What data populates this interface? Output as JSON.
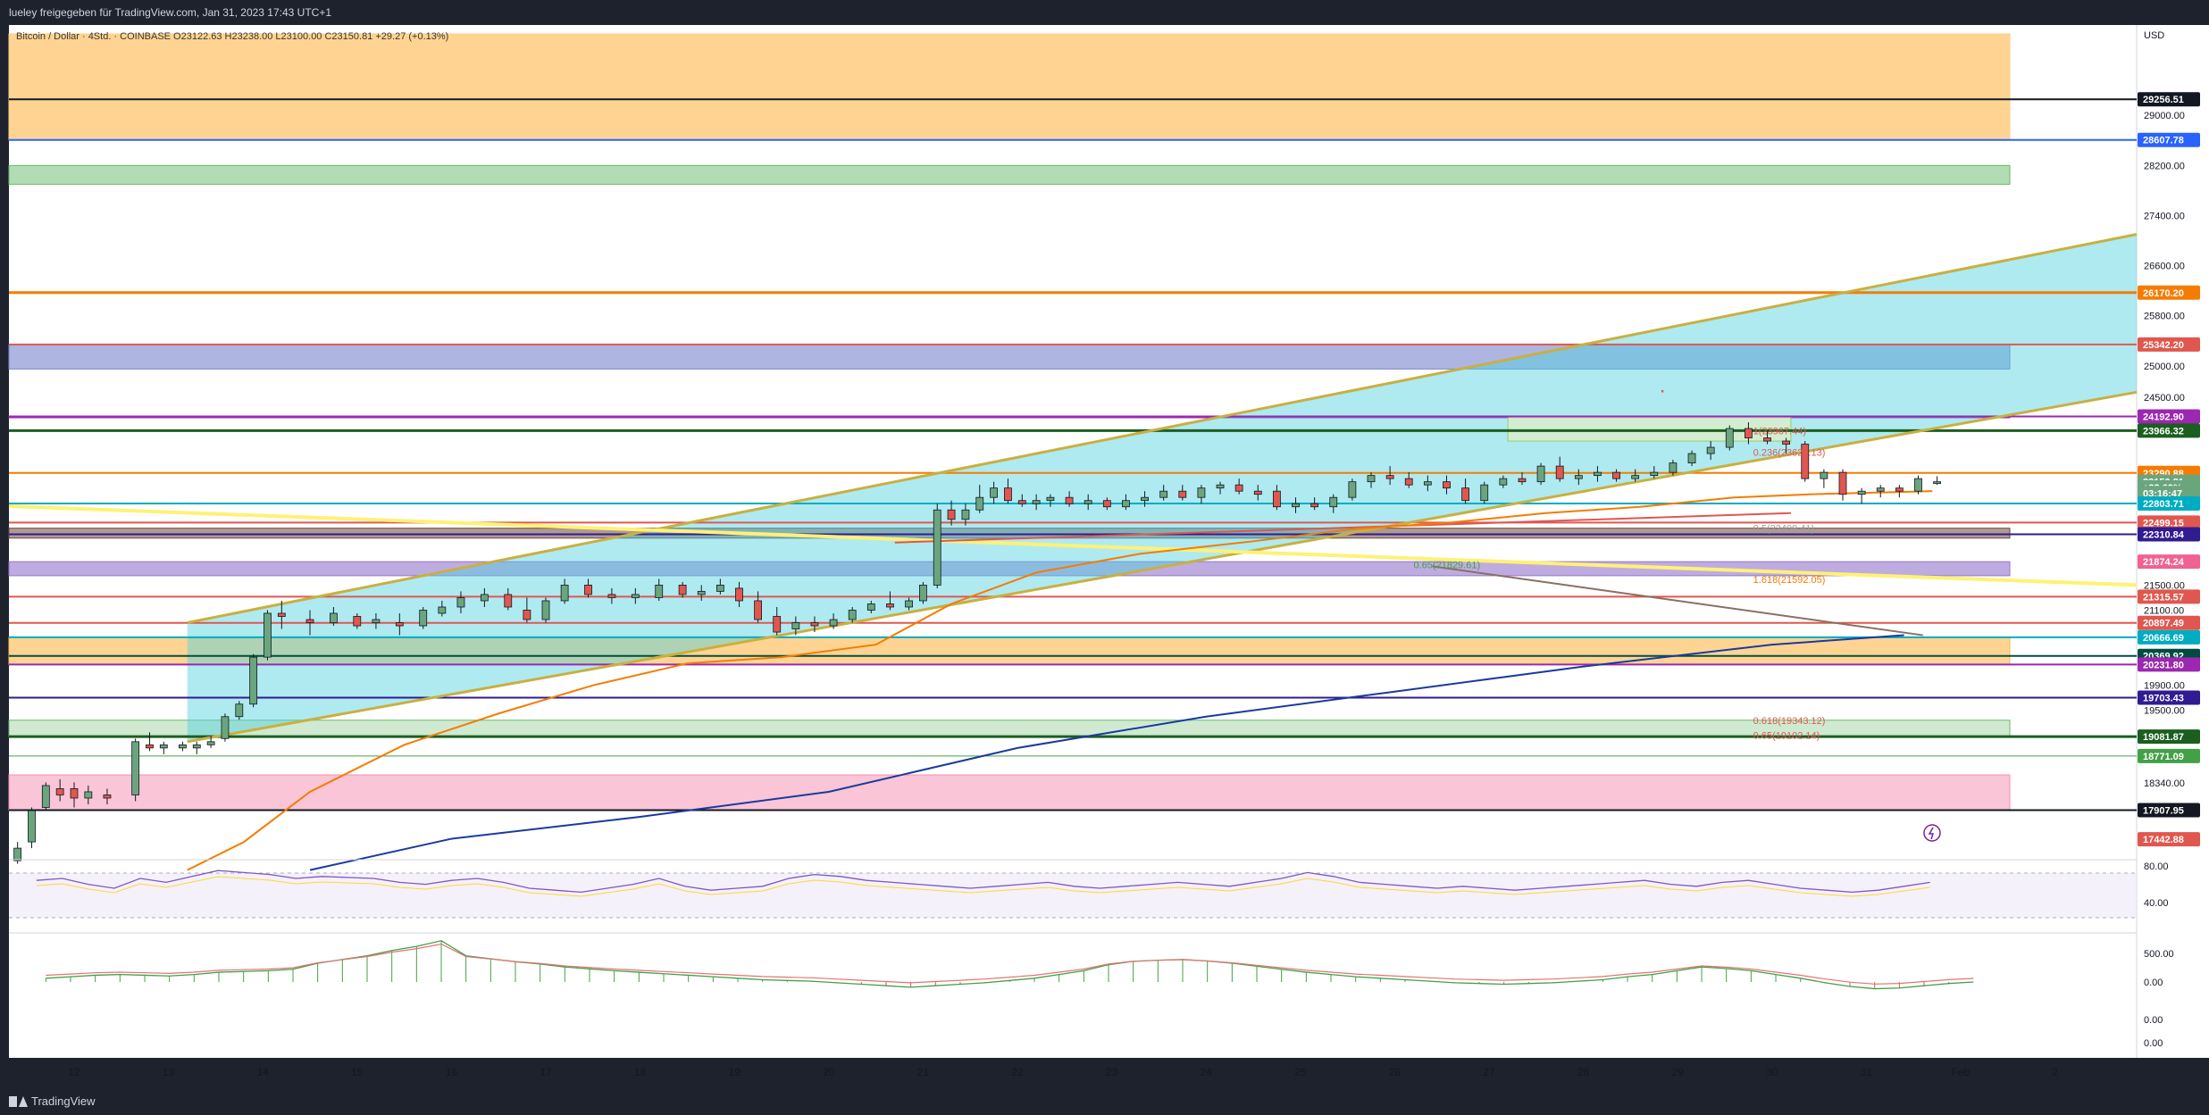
{
  "header": {
    "text": "lueley freigegeben für TradingView.com, Jan 31, 2023 17:43 UTC+1"
  },
  "footer": {
    "brand": "TradingView"
  },
  "legend": {
    "symbol_line": "Bitcoin / Dollar · 4Std. · COINBASE  O23122.63  H23238.00  L23100.00  C23150.81  +29.27 (+0.13%)"
  },
  "colors": {
    "up": "#6aa57e",
    "down": "#e0574f",
    "background": "#ffffff",
    "axis_text": "#131722"
  },
  "chart_data": {
    "type": "candlestick",
    "currency": "USD",
    "ylim": [
      16950,
      30300
    ],
    "x_tick_labels": [
      "12",
      "13",
      "14",
      "15",
      "16",
      "17",
      "18",
      "19",
      "20",
      "21",
      "22",
      "23",
      "24",
      "25",
      "26",
      "27",
      "28",
      "29",
      "30",
      "31",
      "Feb",
      "2"
    ],
    "y_tick_labels": [
      29000,
      28200,
      27400,
      26600,
      25800,
      25000,
      24500,
      21500,
      21100,
      19900,
      19500,
      18340
    ],
    "candles": [
      {
        "x": 11.4,
        "o": 17100,
        "h": 17400,
        "l": 17050,
        "c": 17300
      },
      {
        "x": 11.55,
        "o": 17400,
        "h": 17950,
        "l": 17300,
        "c": 17900
      },
      {
        "x": 11.7,
        "o": 17950,
        "h": 18350,
        "l": 17900,
        "c": 18300
      },
      {
        "x": 11.85,
        "o": 18250,
        "h": 18400,
        "l": 18050,
        "c": 18150
      },
      {
        "x": 12.0,
        "o": 18250,
        "h": 18350,
        "l": 17950,
        "c": 18100
      },
      {
        "x": 12.15,
        "o": 18100,
        "h": 18300,
        "l": 18000,
        "c": 18200
      },
      {
        "x": 12.35,
        "o": 18150,
        "h": 18250,
        "l": 18000,
        "c": 18100
      },
      {
        "x": 12.65,
        "o": 18150,
        "h": 19050,
        "l": 18050,
        "c": 19000
      },
      {
        "x": 12.8,
        "o": 18950,
        "h": 19150,
        "l": 18850,
        "c": 18900
      },
      {
        "x": 12.95,
        "o": 18900,
        "h": 19000,
        "l": 18800,
        "c": 18950
      },
      {
        "x": 13.15,
        "o": 18900,
        "h": 19000,
        "l": 18850,
        "c": 18950
      },
      {
        "x": 13.3,
        "o": 18900,
        "h": 19000,
        "l": 18800,
        "c": 18950
      },
      {
        "x": 13.45,
        "o": 18950,
        "h": 19100,
        "l": 18900,
        "c": 19000
      },
      {
        "x": 13.6,
        "o": 19050,
        "h": 19450,
        "l": 19000,
        "c": 19400
      },
      {
        "x": 13.75,
        "o": 19400,
        "h": 19650,
        "l": 19350,
        "c": 19600
      },
      {
        "x": 13.9,
        "o": 19600,
        "h": 20400,
        "l": 19550,
        "c": 20350
      },
      {
        "x": 14.05,
        "o": 20350,
        "h": 21100,
        "l": 20300,
        "c": 21050
      },
      {
        "x": 14.2,
        "o": 21050,
        "h": 21250,
        "l": 20800,
        "c": 21000
      },
      {
        "x": 14.5,
        "o": 20950,
        "h": 21100,
        "l": 20700,
        "c": 20900
      },
      {
        "x": 14.75,
        "o": 20900,
        "h": 21150,
        "l": 20850,
        "c": 21050
      },
      {
        "x": 15.0,
        "o": 21000,
        "h": 21050,
        "l": 20800,
        "c": 20850
      },
      {
        "x": 15.2,
        "o": 20900,
        "h": 21050,
        "l": 20800,
        "c": 20950
      },
      {
        "x": 15.45,
        "o": 20900,
        "h": 21050,
        "l": 20700,
        "c": 20850
      },
      {
        "x": 15.7,
        "o": 20850,
        "h": 21150,
        "l": 20800,
        "c": 21100
      },
      {
        "x": 15.9,
        "o": 21050,
        "h": 21250,
        "l": 21000,
        "c": 21150
      },
      {
        "x": 16.1,
        "o": 21150,
        "h": 21400,
        "l": 21050,
        "c": 21300
      },
      {
        "x": 16.35,
        "o": 21250,
        "h": 21450,
        "l": 21150,
        "c": 21350
      },
      {
        "x": 16.6,
        "o": 21350,
        "h": 21450,
        "l": 21100,
        "c": 21150
      },
      {
        "x": 16.8,
        "o": 21100,
        "h": 21300,
        "l": 20900,
        "c": 20950
      },
      {
        "x": 17.0,
        "o": 20950,
        "h": 21300,
        "l": 20900,
        "c": 21250
      },
      {
        "x": 17.2,
        "o": 21250,
        "h": 21600,
        "l": 21200,
        "c": 21500
      },
      {
        "x": 17.45,
        "o": 21500,
        "h": 21600,
        "l": 21300,
        "c": 21350
      },
      {
        "x": 17.7,
        "o": 21350,
        "h": 21450,
        "l": 21200,
        "c": 21300
      },
      {
        "x": 17.95,
        "o": 21300,
        "h": 21450,
        "l": 21200,
        "c": 21350
      },
      {
        "x": 18.2,
        "o": 21300,
        "h": 21600,
        "l": 21250,
        "c": 21500
      },
      {
        "x": 18.45,
        "o": 21500,
        "h": 21550,
        "l": 21300,
        "c": 21350
      },
      {
        "x": 18.65,
        "o": 21350,
        "h": 21500,
        "l": 21250,
        "c": 21400
      },
      {
        "x": 18.85,
        "o": 21400,
        "h": 21600,
        "l": 21350,
        "c": 21500
      },
      {
        "x": 19.05,
        "o": 21450,
        "h": 21550,
        "l": 21150,
        "c": 21250
      },
      {
        "x": 19.25,
        "o": 21250,
        "h": 21400,
        "l": 20900,
        "c": 20950
      },
      {
        "x": 19.45,
        "o": 21000,
        "h": 21150,
        "l": 20700,
        "c": 20750
      },
      {
        "x": 19.65,
        "o": 20800,
        "h": 21000,
        "l": 20700,
        "c": 20900
      },
      {
        "x": 19.85,
        "o": 20900,
        "h": 21000,
        "l": 20750,
        "c": 20850
      },
      {
        "x": 20.05,
        "o": 20850,
        "h": 21050,
        "l": 20800,
        "c": 20950
      },
      {
        "x": 20.25,
        "o": 20950,
        "h": 21150,
        "l": 20900,
        "c": 21100
      },
      {
        "x": 20.45,
        "o": 21100,
        "h": 21250,
        "l": 21050,
        "c": 21200
      },
      {
        "x": 20.65,
        "o": 21200,
        "h": 21400,
        "l": 21100,
        "c": 21150
      },
      {
        "x": 20.85,
        "o": 21150,
        "h": 21300,
        "l": 21100,
        "c": 21250
      },
      {
        "x": 21.0,
        "o": 21250,
        "h": 21550,
        "l": 21200,
        "c": 21500
      },
      {
        "x": 21.15,
        "o": 21500,
        "h": 22800,
        "l": 21450,
        "c": 22700
      },
      {
        "x": 21.3,
        "o": 22700,
        "h": 22850,
        "l": 22450,
        "c": 22550
      },
      {
        "x": 21.45,
        "o": 22550,
        "h": 22800,
        "l": 22450,
        "c": 22700
      },
      {
        "x": 21.6,
        "o": 22700,
        "h": 23100,
        "l": 22650,
        "c": 22900
      },
      {
        "x": 21.75,
        "o": 22900,
        "h": 23150,
        "l": 22800,
        "c": 23050
      },
      {
        "x": 21.9,
        "o": 23050,
        "h": 23200,
        "l": 22800,
        "c": 22850
      },
      {
        "x": 22.05,
        "o": 22850,
        "h": 22950,
        "l": 22750,
        "c": 22800
      },
      {
        "x": 22.2,
        "o": 22800,
        "h": 22950,
        "l": 22700,
        "c": 22850
      },
      {
        "x": 22.35,
        "o": 22850,
        "h": 22950,
        "l": 22750,
        "c": 22900
      },
      {
        "x": 22.55,
        "o": 22900,
        "h": 23000,
        "l": 22750,
        "c": 22800
      },
      {
        "x": 22.75,
        "o": 22800,
        "h": 22950,
        "l": 22700,
        "c": 22850
      },
      {
        "x": 22.95,
        "o": 22850,
        "h": 22900,
        "l": 22700,
        "c": 22750
      },
      {
        "x": 23.15,
        "o": 22750,
        "h": 22950,
        "l": 22700,
        "c": 22850
      },
      {
        "x": 23.35,
        "o": 22850,
        "h": 23000,
        "l": 22750,
        "c": 22900
      },
      {
        "x": 23.55,
        "o": 22900,
        "h": 23100,
        "l": 22850,
        "c": 23000
      },
      {
        "x": 23.75,
        "o": 23000,
        "h": 23100,
        "l": 22850,
        "c": 22900
      },
      {
        "x": 23.95,
        "o": 22900,
        "h": 23100,
        "l": 22800,
        "c": 23050
      },
      {
        "x": 24.15,
        "o": 23050,
        "h": 23150,
        "l": 22950,
        "c": 23100
      },
      {
        "x": 24.35,
        "o": 23100,
        "h": 23200,
        "l": 22950,
        "c": 23000
      },
      {
        "x": 24.55,
        "o": 23000,
        "h": 23100,
        "l": 22850,
        "c": 22950
      },
      {
        "x": 24.75,
        "o": 23000,
        "h": 23100,
        "l": 22700,
        "c": 22750
      },
      {
        "x": 24.95,
        "o": 22750,
        "h": 22900,
        "l": 22650,
        "c": 22800
      },
      {
        "x": 25.15,
        "o": 22800,
        "h": 22900,
        "l": 22700,
        "c": 22750
      },
      {
        "x": 25.35,
        "o": 22750,
        "h": 22950,
        "l": 22650,
        "c": 22900
      },
      {
        "x": 25.55,
        "o": 22900,
        "h": 23200,
        "l": 22850,
        "c": 23150
      },
      {
        "x": 25.75,
        "o": 23150,
        "h": 23300,
        "l": 23050,
        "c": 23250
      },
      {
        "x": 25.95,
        "o": 23250,
        "h": 23400,
        "l": 23100,
        "c": 23200
      },
      {
        "x": 26.15,
        "o": 23200,
        "h": 23300,
        "l": 23050,
        "c": 23100
      },
      {
        "x": 26.35,
        "o": 23100,
        "h": 23250,
        "l": 23000,
        "c": 23150
      },
      {
        "x": 26.55,
        "o": 23150,
        "h": 23250,
        "l": 22950,
        "c": 23050
      },
      {
        "x": 26.75,
        "o": 23050,
        "h": 23200,
        "l": 22800,
        "c": 22850
      },
      {
        "x": 26.95,
        "o": 22850,
        "h": 23150,
        "l": 22800,
        "c": 23100
      },
      {
        "x": 27.15,
        "o": 23100,
        "h": 23250,
        "l": 23050,
        "c": 23200
      },
      {
        "x": 27.35,
        "o": 23200,
        "h": 23300,
        "l": 23100,
        "c": 23150
      },
      {
        "x": 27.55,
        "o": 23150,
        "h": 23450,
        "l": 23100,
        "c": 23400
      },
      {
        "x": 27.75,
        "o": 23400,
        "h": 23550,
        "l": 23150,
        "c": 23200
      },
      {
        "x": 27.95,
        "o": 23200,
        "h": 23350,
        "l": 23100,
        "c": 23250
      },
      {
        "x": 28.15,
        "o": 23250,
        "h": 23400,
        "l": 23150,
        "c": 23300
      },
      {
        "x": 28.35,
        "o": 23300,
        "h": 23350,
        "l": 23150,
        "c": 23200
      },
      {
        "x": 28.55,
        "o": 23200,
        "h": 23350,
        "l": 23150,
        "c": 23250
      },
      {
        "x": 28.75,
        "o": 23250,
        "h": 23400,
        "l": 23200,
        "c": 23300
      },
      {
        "x": 28.95,
        "o": 23300,
        "h": 23500,
        "l": 23250,
        "c": 23450
      },
      {
        "x": 29.15,
        "o": 23450,
        "h": 23650,
        "l": 23400,
        "c": 23600
      },
      {
        "x": 29.35,
        "o": 23600,
        "h": 23800,
        "l": 23500,
        "c": 23700
      },
      {
        "x": 29.55,
        "o": 23700,
        "h": 24050,
        "l": 23650,
        "c": 24000
      },
      {
        "x": 29.75,
        "o": 24000,
        "h": 24100,
        "l": 23750,
        "c": 23850
      },
      {
        "x": 29.95,
        "o": 23850,
        "h": 23950,
        "l": 23750,
        "c": 23800
      },
      {
        "x": 30.15,
        "o": 23800,
        "h": 23850,
        "l": 23600,
        "c": 23750
      },
      {
        "x": 30.35,
        "o": 23750,
        "h": 23800,
        "l": 23150,
        "c": 23200
      },
      {
        "x": 30.55,
        "o": 23200,
        "h": 23350,
        "l": 23050,
        "c": 23300
      },
      {
        "x": 30.75,
        "o": 23300,
        "h": 23350,
        "l": 22850,
        "c": 22950
      },
      {
        "x": 30.95,
        "o": 22950,
        "h": 23050,
        "l": 22800,
        "c": 23000
      },
      {
        "x": 31.15,
        "o": 23000,
        "h": 23100,
        "l": 22900,
        "c": 23050
      },
      {
        "x": 31.35,
        "o": 23050,
        "h": 23100,
        "l": 22900,
        "c": 23000
      },
      {
        "x": 31.55,
        "o": 23000,
        "h": 23250,
        "l": 22950,
        "c": 23200
      },
      {
        "x": 31.75,
        "o": 23150,
        "h": 23238,
        "l": 23100,
        "c": 23150
      }
    ],
    "fib_labels": [
      "1(23967.44)",
      "0.236(23621.13)",
      "0.5(22409.41)",
      "0.65(21829.61)",
      "1.618(21592.05)",
      "0.618(19343.12)",
      "0.65(19102.14)"
    ],
    "price_labels": [
      {
        "value": "29256.51",
        "bg": "#131722"
      },
      {
        "value": "28607.78",
        "bg": "#2962ff"
      },
      {
        "value": "26170.20",
        "bg": "#f57c00"
      },
      {
        "value": "25342.20",
        "bg": "#e0574f"
      },
      {
        "value": "24192.90",
        "bg": "#9c27b0"
      },
      {
        "value": "23966.32",
        "bg": "#1b5e20"
      },
      {
        "value": "23290.88",
        "bg": "#f57c00"
      },
      {
        "value": "23150.81",
        "bg": "#6aa57e"
      },
      {
        "value": "+32.69%",
        "bg": "#6aa57e"
      },
      {
        "value": "03:16:47",
        "bg": "#6aa57e"
      },
      {
        "value": "22803.71",
        "bg": "#00acc1"
      },
      {
        "value": "22499.15",
        "bg": "#e0574f"
      },
      {
        "value": "22310.84",
        "bg": "#311b92"
      },
      {
        "value": "21874.24",
        "bg": "#f06292"
      },
      {
        "value": "21315.57",
        "bg": "#e0574f"
      },
      {
        "value": "20897.49",
        "bg": "#e0574f"
      },
      {
        "value": "20666.69",
        "bg": "#00acc1"
      },
      {
        "value": "20369.92",
        "bg": "#004d40"
      },
      {
        "value": "20231.80",
        "bg": "#9c27b0"
      },
      {
        "value": "19703.43",
        "bg": "#311b92"
      },
      {
        "value": "19081.87",
        "bg": "#1b5e20"
      },
      {
        "value": "18771.09",
        "bg": "#43a047"
      },
      {
        "value": "17907.95",
        "bg": "#131722"
      },
      {
        "value": "17442.88",
        "bg": "#e0574f"
      }
    ],
    "rsi": {
      "levels": [
        80.0,
        40.0
      ]
    },
    "macd": {
      "levels": [
        500.0,
        0.0,
        0.0,
        0.0
      ]
    }
  }
}
